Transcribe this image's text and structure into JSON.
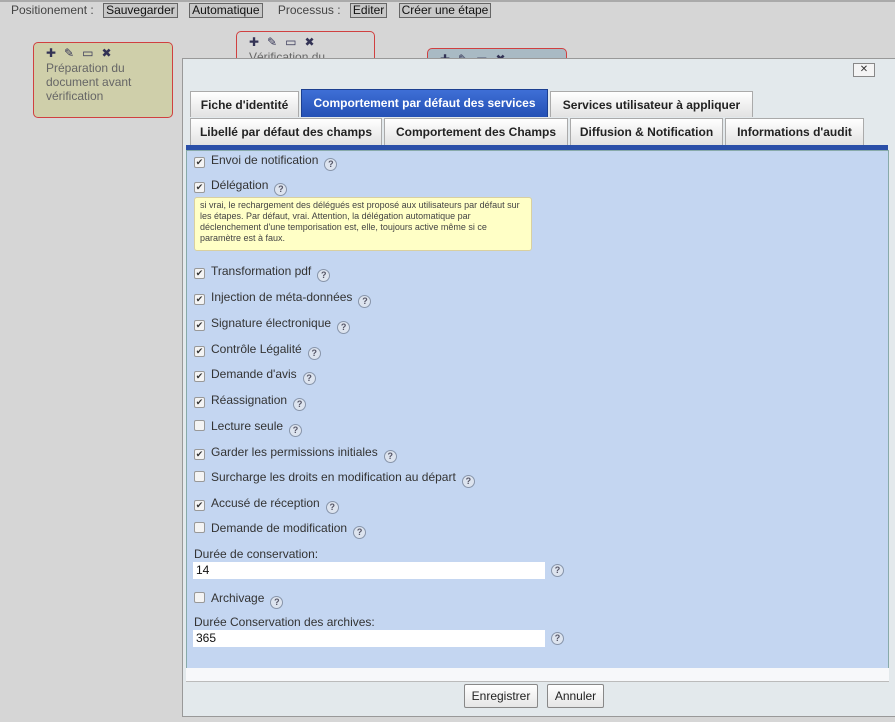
{
  "toolbar": {
    "positionnement_label": "Positionement :",
    "save": "Sauvegarder",
    "auto": "Automatique",
    "processus_label": "Processus :",
    "edit": "Editer",
    "create_step": "Créer une étape"
  },
  "nodes": [
    {
      "label": "Préparation du document avant vérification"
    },
    {
      "label": "Vérification du"
    },
    {
      "label": ""
    }
  ],
  "dialog": {
    "close": "✕",
    "tabs_row1": [
      {
        "label": "Fiche d'identité"
      },
      {
        "label": "Comportement par défaut des services",
        "active": true
      },
      {
        "label": "Services utilisateur à appliquer"
      }
    ],
    "tabs_row2": [
      {
        "label": "Libellé par défaut des champs"
      },
      {
        "label": "Comportement des Champs"
      },
      {
        "label": "Diffusion & Notification"
      },
      {
        "label": "Informations d'audit"
      }
    ],
    "options": [
      {
        "label": "Envoi de notification",
        "checked": true
      },
      {
        "label": "Délégation",
        "checked": true
      },
      {
        "label": "Transformation pdf",
        "checked": true
      },
      {
        "label": "Injection de méta-données",
        "checked": true
      },
      {
        "label": "Signature électronique",
        "checked": true
      },
      {
        "label": "Contrôle Légalité",
        "checked": true
      },
      {
        "label": "Demande d'avis",
        "checked": true
      },
      {
        "label": "Réassignation",
        "checked": true
      },
      {
        "label": "Lecture seule",
        "checked": false
      },
      {
        "label": "Garder les permissions initiales",
        "checked": true
      },
      {
        "label": "Surcharge les droits en modification au départ",
        "checked": false
      },
      {
        "label": "Accusé de réception",
        "checked": true
      },
      {
        "label": "Demande de modification",
        "checked": false
      }
    ],
    "tooltip": "si vrai, le rechargement des délégués est proposé aux utilisateurs par défaut sur les étapes. Par défaut, vrai. Attention, la délégation automatique par déclenchement d'une temporisation est, elle, toujours active même si ce paramètre est à faux.",
    "retention_label": "Durée de conservation:",
    "retention_value": "14",
    "archiving": {
      "label": "Archivage",
      "checked": false
    },
    "archive_retention_label": "Durée Conservation des archives:",
    "archive_retention_value": "365",
    "save": "Enregistrer",
    "cancel": "Annuler"
  }
}
